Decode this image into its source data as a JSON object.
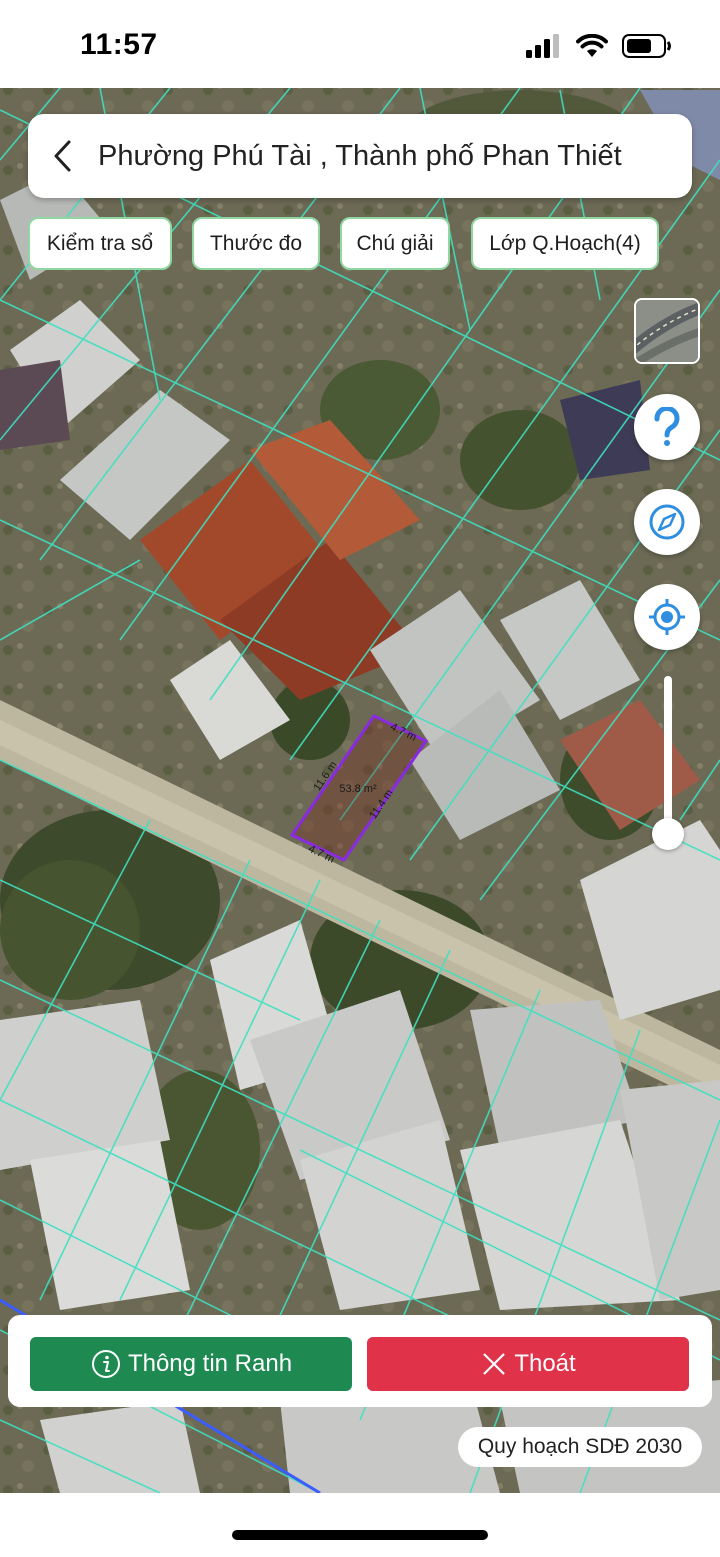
{
  "status_bar": {
    "time": "11:57"
  },
  "header": {
    "title": "Phường Phú Tài , Thành phố Phan Thiết"
  },
  "toolbar": [
    {
      "label": "Kiểm tra sổ"
    },
    {
      "label": "Thước đo"
    },
    {
      "label": "Chú giải"
    },
    {
      "label": "Lớp Q.Hoạch(4)"
    }
  ],
  "map": {
    "plot": {
      "area": "53.8 m²",
      "top_edge": "4.7 m",
      "bottom_edge": "4.7 m",
      "left_edge": "11.6 m",
      "right_edge": "11.4 m",
      "outline_color": "#8a2be2"
    },
    "parcel_line_color": "#3fe0c0"
  },
  "controls": {
    "help_icon": "question-icon",
    "compass_icon": "compass-icon",
    "locate_icon": "locate-icon",
    "zoom_level": 0.9
  },
  "bottom": {
    "info_label": "Thông tin Ranh",
    "exit_label": "Thoát",
    "info_color": "#1e8a52",
    "exit_color": "#e0334a"
  },
  "plan_chip": "Quy hoạch SDĐ 2030"
}
